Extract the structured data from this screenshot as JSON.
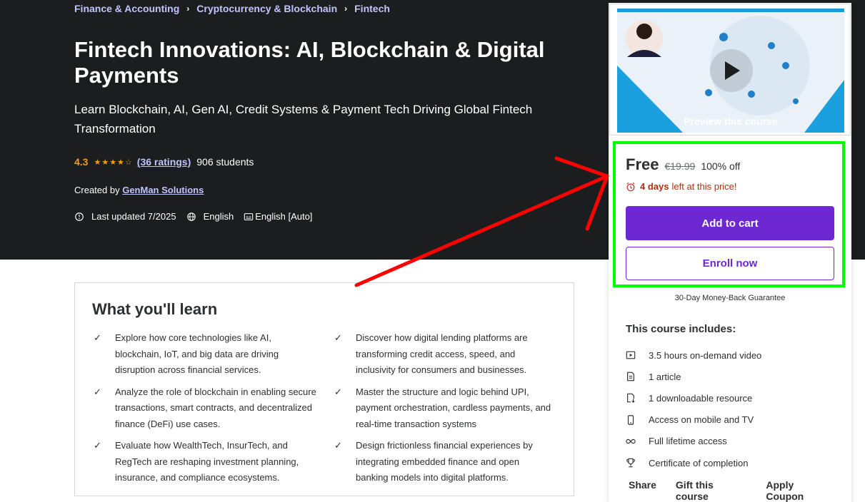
{
  "breadcrumb": [
    "Finance & Accounting",
    "Cryptocurrency & Blockchain",
    "Fintech"
  ],
  "course": {
    "title": "Fintech Innovations: AI, Blockchain & Digital Payments",
    "subtitle": "Learn Blockchain, AI, Gen AI, Credit Systems & Payment Tech Driving Global Fintech Transformation",
    "rating": "4.3",
    "rating_value": 4.3,
    "ratings_link": "(36 ratings)",
    "students": "906 students",
    "created_by_label": "Created by",
    "author": "GenMan Solutions",
    "last_updated": "Last updated 7/2025",
    "language": "English",
    "captions": "English [Auto]"
  },
  "learn": {
    "title": "What you'll learn",
    "items": [
      "Explore how core technologies like AI, blockchain, IoT, and big data are driving disruption across financial services.",
      "Discover how digital lending platforms are transforming credit access, speed, and inclusivity for consumers and businesses.",
      "Analyze the role of blockchain in enabling secure transactions, smart contracts, and decentralized finance (DeFi) use cases.",
      "Master the structure and logic behind UPI, payment orchestration, cardless payments, and real-time transaction systems",
      "Evaluate how WealthTech, InsurTech, and RegTech are reshaping investment planning, insurance, and compliance ecosystems.",
      "Design frictionless financial experiences by integrating embedded finance and open banking models into digital platforms."
    ]
  },
  "sidebar": {
    "preview_label": "Preview this course",
    "price": "Free",
    "original_price": "€19.99",
    "discount": "100% off",
    "timer_bold": "4 days",
    "timer_rest": "left at this price!",
    "add_to_cart": "Add to cart",
    "enroll_now": "Enroll now",
    "guarantee": "30-Day Money-Back Guarantee",
    "includes_title": "This course includes:",
    "includes": [
      {
        "icon": "video-icon",
        "label": "3.5 hours on-demand video"
      },
      {
        "icon": "article-icon",
        "label": "1 article"
      },
      {
        "icon": "download-icon",
        "label": "1 downloadable resource"
      },
      {
        "icon": "mobile-icon",
        "label": "Access on mobile and TV"
      },
      {
        "icon": "infinity-icon",
        "label": "Full lifetime access"
      },
      {
        "icon": "trophy-icon",
        "label": "Certificate of completion"
      }
    ],
    "share": "Share",
    "gift": "Gift this course",
    "coupon": "Apply Coupon"
  },
  "colors": {
    "hero_bg": "#1c1d1f",
    "link_purple": "#c0c4fc",
    "star": "#f69c08",
    "cta": "#6d28d2",
    "highlight_box": "#00ff00",
    "arrow": "#ff0000",
    "timer": "#b32d0f"
  }
}
